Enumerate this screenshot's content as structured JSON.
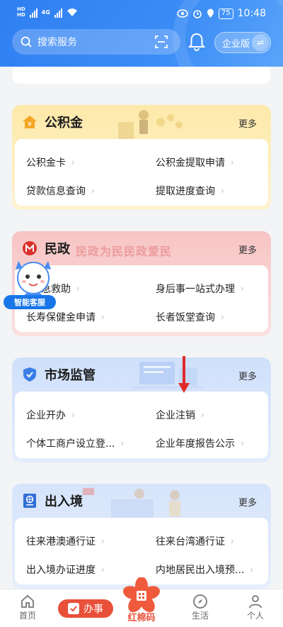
{
  "status_bar": {
    "sim1": "HD",
    "sim2": "HD",
    "network": "4G",
    "battery": "75",
    "time": "10:48"
  },
  "header": {
    "search_placeholder": "搜索服务",
    "org_label": "企业版"
  },
  "more_label": "更多",
  "cards": [
    {
      "id": "housing-fund",
      "title": "公积金",
      "items": [
        "公积金卡",
        "公积金提取申请",
        "贷款信息查询",
        "提取进度查询"
      ]
    },
    {
      "id": "civil-affairs",
      "title": "民政",
      "banner": "民政为民民政爱民",
      "items": [
        "急救助",
        "身后事一站式办理",
        "长寿保健金申请",
        "长者饭堂查询"
      ]
    },
    {
      "id": "market-supervision",
      "title": "市场监管",
      "items": [
        "企业开办",
        "企业注销",
        "个体工商户设立登...",
        "企业年度报告公示"
      ]
    },
    {
      "id": "immigration",
      "title": "出入境",
      "items": [
        "往来港澳通行证",
        "往来台湾通行证",
        "出入境办证进度",
        "内地居民出入境预..."
      ]
    }
  ],
  "assistant_label": "智能客服",
  "tabbar": {
    "home": "首页",
    "action": "办事",
    "center": "红棉码",
    "life": "生活",
    "personal": "个人"
  },
  "colors": {
    "header_blue": "#2f7ff2",
    "fund_yellow": "#fbe7a6",
    "civil_red": "#f9c9c9",
    "market_blue": "#d4e3fb",
    "immigration_blue": "#dde8fb",
    "action_red": "#e8503a"
  }
}
